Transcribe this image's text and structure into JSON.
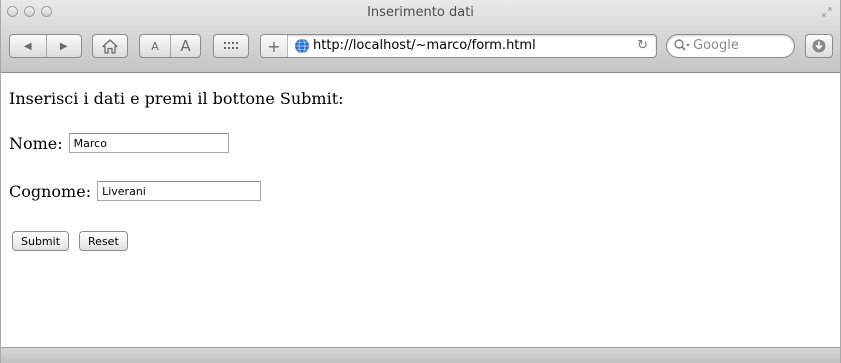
{
  "window": {
    "title": "Inserimento dati"
  },
  "toolbar": {
    "back_icon": "◀",
    "forward_icon": "▶",
    "text_smaller_label": "A",
    "text_larger_label": "A",
    "add_bookmark_icon": "+",
    "reload_icon": "↻"
  },
  "address_bar": {
    "url": "http://localhost/~marco/form.html"
  },
  "search": {
    "placeholder": "Google"
  },
  "page": {
    "instructions": "Inserisci i dati e premi il bottone Submit:",
    "nome_label": "Nome:",
    "nome_value": "Marco",
    "cognome_label": "Cognome:",
    "cognome_value": "Liverani",
    "submit_label": "Submit",
    "reset_label": "Reset"
  },
  "icons": {
    "home": "home-icon",
    "topsites": "grid-icon",
    "globe": "globe-icon",
    "search": "magnifier-icon",
    "downloads": "downloads-icon",
    "resize": "fullscreen-icon"
  },
  "colors": {
    "globe": "#2a6fd1",
    "chrome_top": "#e9e9e9",
    "chrome_bottom": "#c5c5c5"
  }
}
